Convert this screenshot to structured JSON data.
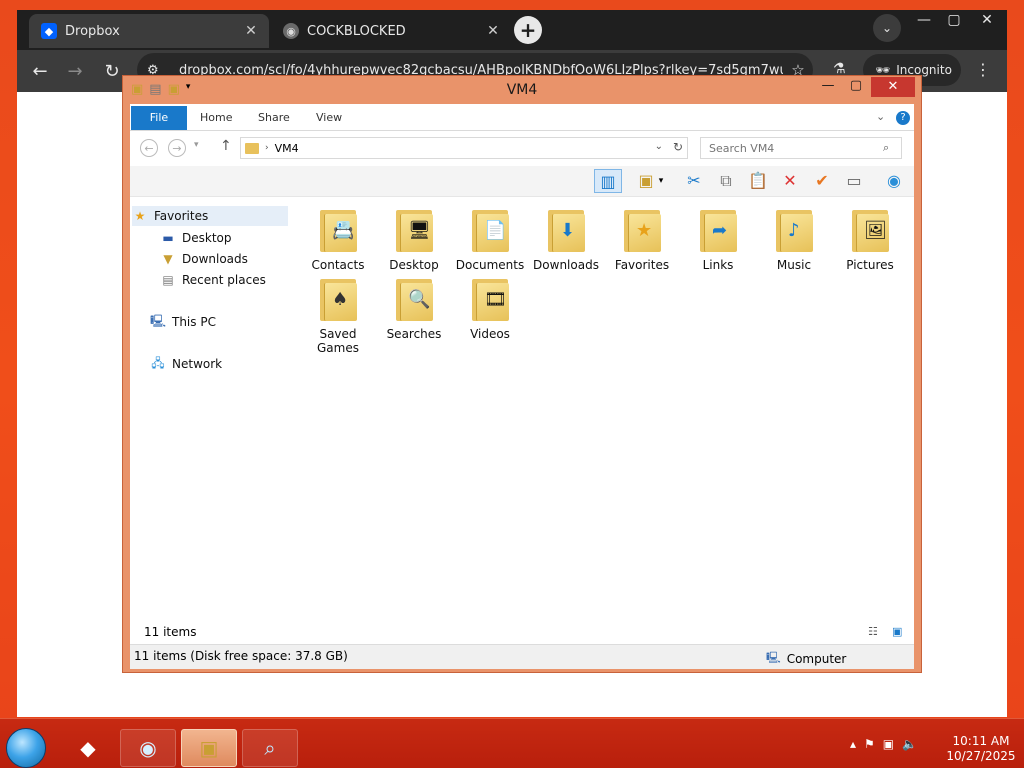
{
  "browser": {
    "tabs": [
      {
        "label": "Dropbox",
        "active": true
      },
      {
        "label": "COCKBLOCKED",
        "active": false
      }
    ],
    "url": "dropbox.com/scl/fo/4yhhurepwvec82gcbacsu/AHBpoIKBNDbfOoW6LIzPlps?rlkey=7sd5gm7wu...",
    "incognito_label": "Incognito"
  },
  "explorer": {
    "title": "VM4",
    "ribbon_tabs": [
      "File",
      "Home",
      "Share",
      "View"
    ],
    "address": "VM4",
    "search_placeholder": "Search VM4",
    "nav": {
      "favorites": "Favorites",
      "desktop": "Desktop",
      "downloads": "Downloads",
      "recent": "Recent places",
      "this_pc": "This PC",
      "network": "Network"
    },
    "items": [
      {
        "label": "Contacts",
        "glyph": "📇"
      },
      {
        "label": "Desktop",
        "glyph": "🖥"
      },
      {
        "label": "Documents",
        "glyph": "📄"
      },
      {
        "label": "Downloads",
        "glyph": "⬇"
      },
      {
        "label": "Favorites",
        "glyph": "★"
      },
      {
        "label": "Links",
        "glyph": "➦"
      },
      {
        "label": "Music",
        "glyph": "♪"
      },
      {
        "label": "Pictures",
        "glyph": "🖼"
      },
      {
        "label": "Saved Games",
        "glyph": "♠"
      },
      {
        "label": "Searches",
        "glyph": "🔍"
      },
      {
        "label": "Videos",
        "glyph": "🎞"
      }
    ],
    "item_count": "11 items",
    "status_left": "11 items (Disk free space: 37.8 GB)",
    "status_right": "Computer"
  },
  "taskbar": {
    "time": "10:11 AM",
    "date": "10/27/2025"
  },
  "colors": {
    "desktop_bg": "#e94a1c",
    "window_frame": "#e9936a",
    "file_tab": "#1979ca",
    "close_button": "#c7372f"
  }
}
